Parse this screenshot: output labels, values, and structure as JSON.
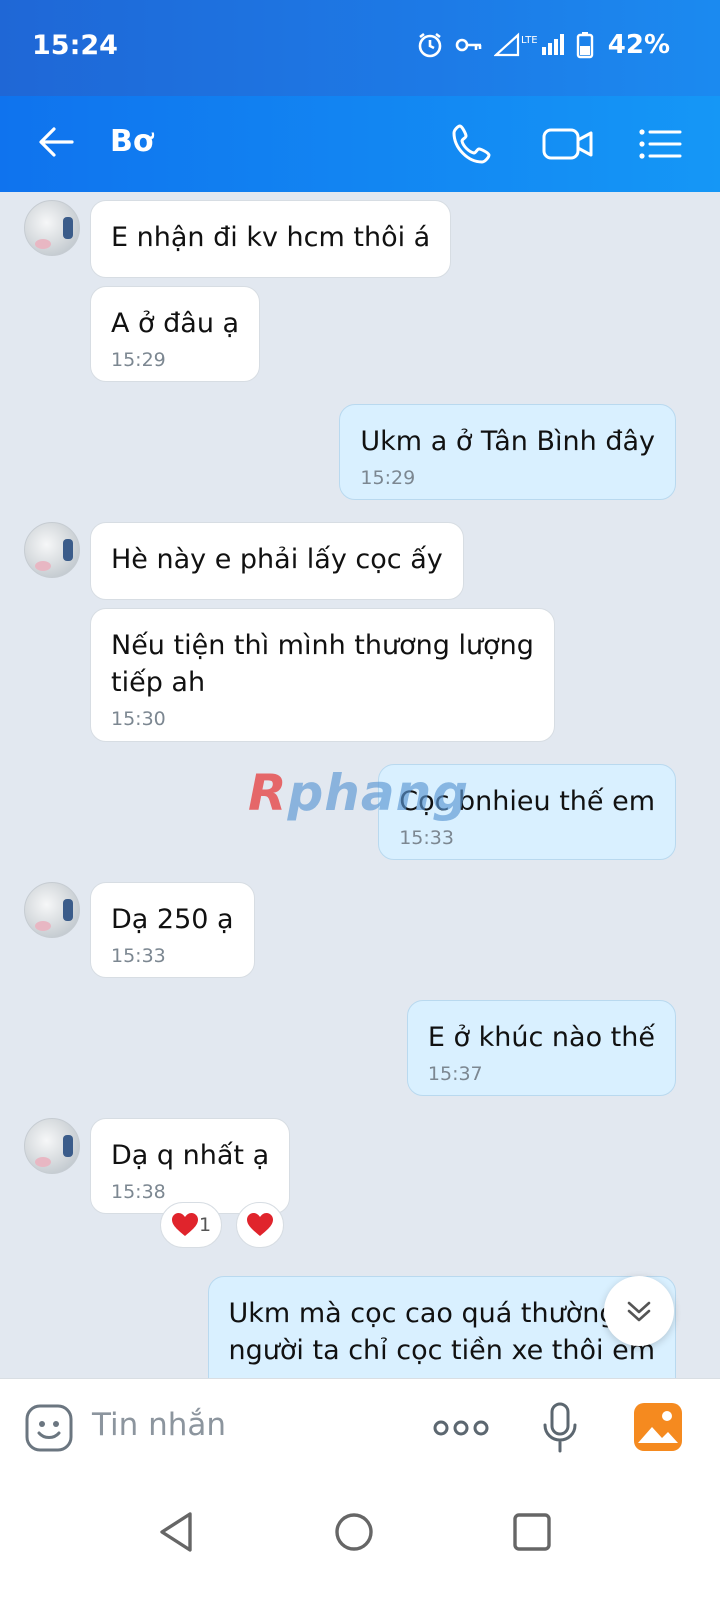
{
  "status_bar": {
    "time": "15:24",
    "network": "LTE",
    "battery": "42%"
  },
  "header": {
    "contact_name": "Bơ"
  },
  "colors": {
    "header": "#1597f6",
    "incoming_bubble": "#ffffff",
    "outgoing_bubble": "#d9f0ff",
    "heart": "#e0242c"
  },
  "watermark": {
    "lead": "R",
    "rest": "phang"
  },
  "messages": [
    {
      "direction": "in",
      "text": "E nhận đi kv hcm thôi á",
      "time": ""
    },
    {
      "direction": "in",
      "text": "A ở đâu ạ",
      "time": "15:29"
    },
    {
      "direction": "out",
      "text": "Ukm a ở Tân Bình đây",
      "time": "15:29"
    },
    {
      "direction": "in",
      "text": "Hè này e phải lấy cọc ấy",
      "time": ""
    },
    {
      "direction": "in",
      "text": "Nếu tiện thì mình thương lượng\ntiếp ah",
      "time": "15:30"
    },
    {
      "direction": "out",
      "text": "Cọc bnhieu thế em",
      "time": "15:33"
    },
    {
      "direction": "in",
      "text": "Dạ 250 ạ",
      "time": "15:33"
    },
    {
      "direction": "out",
      "text": "E ở khúc nào thế",
      "time": "15:37"
    },
    {
      "direction": "in",
      "text": "Dạ q nhất ạ",
      "time": "15:38"
    },
    {
      "direction": "out",
      "text": "Ukm mà cọc cao quá thường\nngười ta chỉ cọc tiền xe thôi em",
      "time": ""
    }
  ],
  "reaction": {
    "count": "1",
    "icon": "heart-icon"
  },
  "input": {
    "placeholder": "Tin nhắn"
  }
}
